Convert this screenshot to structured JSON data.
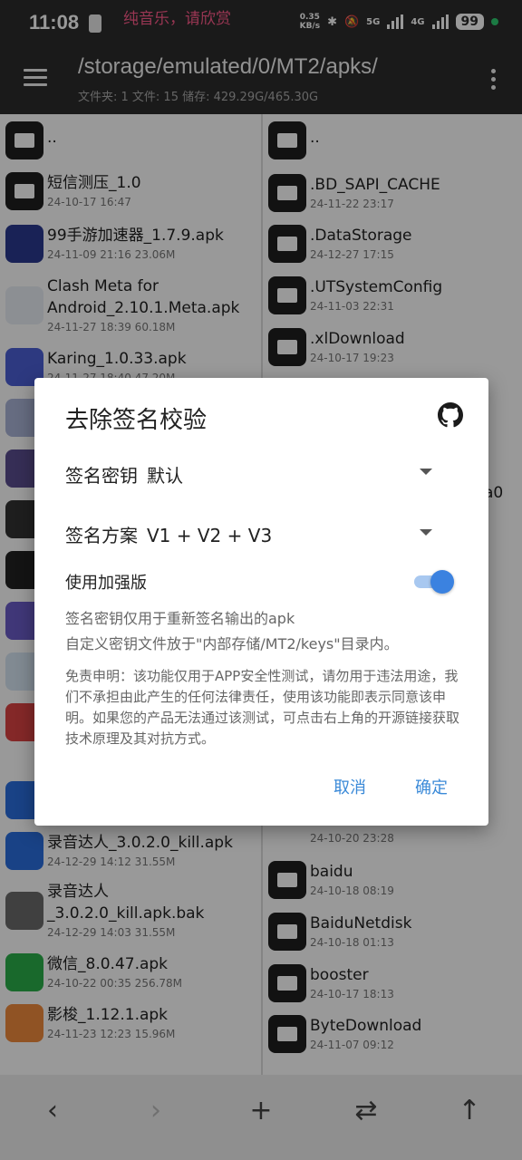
{
  "status_bar": {
    "time": "11:08",
    "music": "纯音乐，请欣赏",
    "net_speed": "0.35",
    "net_unit": "KB/s",
    "sig1": "5G",
    "sig2": "4G",
    "battery": "99"
  },
  "appbar": {
    "path": "/storage/emulated/0/MT2/apks/",
    "info": "文件夹: 1  文件: 15  储存: 429.29G/465.30G"
  },
  "left_pane": [
    {
      "name": "..",
      "meta": ""
    },
    {
      "name": "短信测压_1.0",
      "meta": "24-10-17 16:47"
    },
    {
      "name": "99手游加速器_1.7.9.apk",
      "meta": "24-11-09 21:16  23.06M"
    },
    {
      "name": "Clash Meta for Android_2.10.1.Meta.apk",
      "meta": "24-11-27 18:39  60.18M"
    },
    {
      "name": "Karing_1.0.33.apk",
      "meta": "24-11-27 18:40  47.20M"
    },
    {
      "name": "录音达人_3.0.2.0_kill.apk",
      "meta": "24-12-29 14:12  31.55M"
    },
    {
      "name": "录音达人_3.0.2.0_kill.apk.bak",
      "meta": "24-12-29 14:03  31.55M"
    },
    {
      "name": "微信_8.0.47.apk",
      "meta": "24-10-22 00:35  256.78M"
    },
    {
      "name": "影梭_1.12.1.apk",
      "meta": "24-11-23 12:23  15.96M"
    }
  ],
  "right_pane": [
    {
      "name": "..",
      "meta": ""
    },
    {
      "name": ".BD_SAPI_CACHE",
      "meta": "24-11-22 23:17"
    },
    {
      "name": ".DataStorage",
      "meta": "24-12-27 17:15"
    },
    {
      "name": ".UTSystemConfig",
      "meta": "24-11-03 22:31"
    },
    {
      "name": ".xlDownload",
      "meta": "24-10-17 19:23"
    },
    {
      "name": "",
      "meta": "24-10-20 23:28"
    },
    {
      "name": "baidu",
      "meta": "24-10-18 08:19"
    },
    {
      "name": "BaiduNetdisk",
      "meta": "24-10-18 01:13"
    },
    {
      "name": "booster",
      "meta": "24-10-17 18:13"
    },
    {
      "name": "ByteDownload",
      "meta": "24-11-07 09:12"
    }
  ],
  "right_partial": "a0",
  "dialog": {
    "title": "去除签名校验",
    "key_label": "签名密钥",
    "key_value": "默认",
    "scheme_label": "签名方案",
    "scheme_value": "V1 + V2 + V3",
    "enhanced_label": "使用加强版",
    "enhanced_on": true,
    "hint1": "签名密钥仅用于重新签名输出的apk",
    "hint2": "自定义密钥文件放于\"内部存储/MT2/keys\"目录内。",
    "disclaimer": "免责申明：该功能仅用于APP安全性测试，请勿用于违法用途，我们不承担由此产生的任何法律责任，使用该功能即表示同意该申明。如果您的产品无法通过该测试，可点击右上角的开源链接获取技术原理及其对抗方式。",
    "cancel": "取消",
    "ok": "确定"
  },
  "bottom_bar": {
    "back": "‹",
    "forward": "›",
    "add": "+",
    "swap": "⇄",
    "up": "↑"
  },
  "colors": {
    "accent": "#3b8ad8",
    "header_bg": "#2c2c2c",
    "toggle_on": "#3b82e0"
  }
}
